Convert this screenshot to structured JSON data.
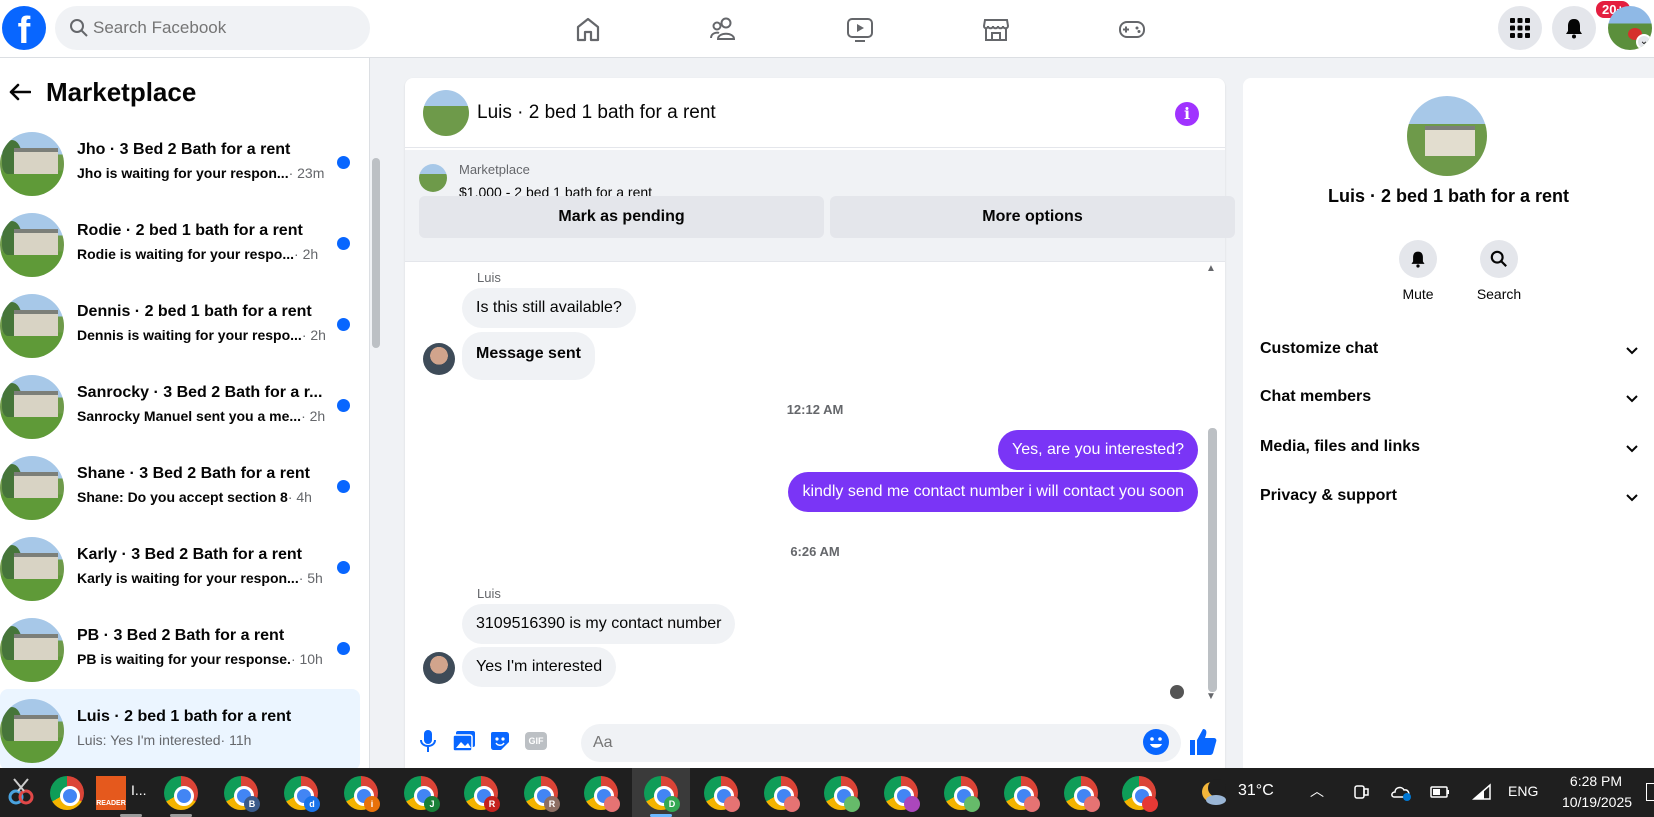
{
  "header": {
    "logo": "f",
    "search_placeholder": "Search Facebook",
    "nav": [
      "home-icon",
      "friends-icon",
      "video-icon",
      "marketplace-icon",
      "gaming-icon"
    ],
    "notif_badge": "20+"
  },
  "left": {
    "title": "Marketplace",
    "conversations": [
      {
        "name": "Jho · 3 Bed 2 Bath for a rent",
        "snippet": "Jho is waiting for your respon...",
        "time": "· 23m"
      },
      {
        "name": "Rodie · 2 bed 1 bath for a rent",
        "snippet": "Rodie is waiting for your respo...",
        "time": "· 2h"
      },
      {
        "name": "Dennis · 2 bed 1 bath for a rent",
        "snippet": "Dennis is waiting for your respo...",
        "time": "· 2h"
      },
      {
        "name": "Sanrocky · 3 Bed 2 Bath for a r...",
        "snippet": "Sanrocky Manuel sent you a me...",
        "time": "· 2h"
      },
      {
        "name": "Shane · 3 Bed 2 Bath for a rent",
        "snippet": "Shane: Do you accept section 8",
        "time": "· 4h"
      },
      {
        "name": "Karly · 3 Bed 2 Bath for a rent",
        "snippet": "Karly is waiting for your respon...",
        "time": "· 5h"
      },
      {
        "name": "PB · 3 Bed 2 Bath for a rent",
        "snippet": "PB is waiting for your response.",
        "time": "· 10h"
      },
      {
        "name": "Luis · 2 bed 1 bath for a rent",
        "snippet": "Luis: Yes I'm interested",
        "time": "· 11h"
      }
    ]
  },
  "chat": {
    "title": "Luis · 2 bed 1 bath for a rent",
    "listing_source": "Marketplace",
    "listing_price": "$1,000 - 2 bed 1 bath for a rent",
    "btn_pending": "Mark as pending",
    "btn_more": "More options",
    "sender1": "Luis",
    "msg1": "Is this still available?",
    "msg2": "Message sent",
    "ts1": "12:12 AM",
    "msg3": "Yes, are you interested?",
    "msg4": "kindly send me contact number i will contact you soon",
    "ts2": "6:26 AM",
    "sender2": "Luis",
    "msg5": "3109516390 is my contact number",
    "msg6": "Yes I'm interested",
    "composer_placeholder": "Aa",
    "gif_label": "GIF"
  },
  "right": {
    "title": "Luis · 2 bed 1 bath for a rent",
    "mute": "Mute",
    "search": "Search",
    "rows": [
      "Customize chat",
      "Chat members",
      "Media, files and links",
      "Privacy & support"
    ]
  },
  "taskbar": {
    "reader_label": "READER",
    "reader_title": "I...",
    "tab_letters": [
      "",
      "B",
      "d",
      "i",
      "J",
      "R",
      "R",
      "",
      "D",
      "",
      "",
      "",
      "",
      "",
      "",
      "",
      ""
    ],
    "weather": "31°C",
    "lang": "ENG",
    "time": "6:28 PM",
    "date": "10/19/2025"
  },
  "colors": {
    "brand": "#0866ff",
    "outgoing": "#7a35f6",
    "badge": "#e41e3f"
  }
}
